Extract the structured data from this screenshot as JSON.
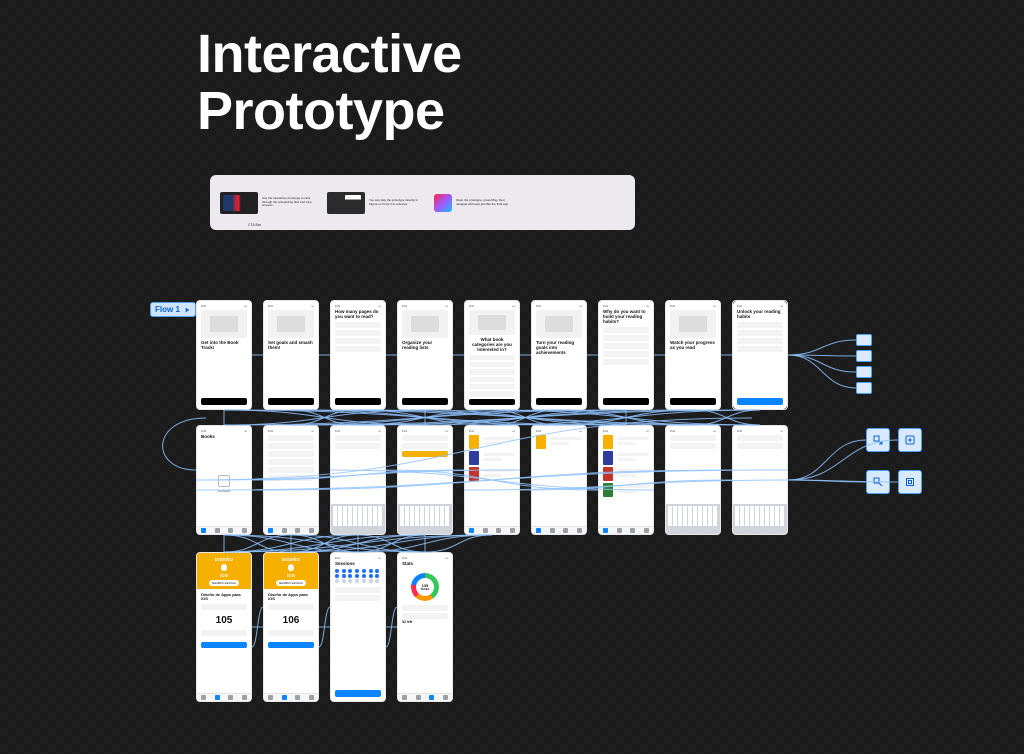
{
  "title_line1": "Interactive",
  "title_line2": "Prototype",
  "demo": {
    "caption": "CTA Bar",
    "note1": "Use the interactive prototype to click through the onboarding flow and core screens.",
    "note2": "You can play the prototype directly in Figma or mirror it to a device.",
    "note3": "Open the prototype, press Play, then navigate with taps just like the final app."
  },
  "flow_badge": "Flow 1",
  "row1": [
    {
      "heading": "Get into the Book Track!",
      "btn": "black"
    },
    {
      "heading": "Set goals and smash them!",
      "btn": "black"
    },
    {
      "heading": "How many pages do you want to read?",
      "btn": "black",
      "list": 4
    },
    {
      "heading": "Organize your reading lists",
      "btn": "black"
    },
    {
      "heading": "What book categories are you interested in?",
      "btn": "black",
      "list": 6,
      "center": true
    },
    {
      "heading": "Turn your reading goals into achievements",
      "btn": "black"
    },
    {
      "heading": "Why do you want to build your reading habits?",
      "btn": "black",
      "list": 5
    },
    {
      "heading": "Watch your progress as you read",
      "btn": "black"
    },
    {
      "heading": "Unlock your reading habits",
      "btn": "blue",
      "frame": true,
      "list": 4
    }
  ],
  "row2": [
    {
      "title": "Books",
      "type": "empty"
    },
    {
      "title": "",
      "type": "list",
      "rows": 6
    },
    {
      "title": "",
      "type": "keyboard"
    },
    {
      "title": "",
      "type": "keyboard",
      "marked": true
    },
    {
      "title": "",
      "type": "booklist",
      "thumbs": [
        "#f6b000",
        "#2f3e9e",
        "#c1352b"
      ]
    },
    {
      "title": "",
      "type": "booklist",
      "thumbs": [
        "#f6b000"
      ]
    },
    {
      "title": "",
      "type": "booklist",
      "thumbs": [
        "#f6b000",
        "#2f3e9e",
        "#c1352b",
        "#2e7d32"
      ]
    },
    {
      "title": "",
      "type": "keyboard"
    },
    {
      "title": "",
      "type": "keyboard"
    }
  ],
  "row3": [
    {
      "type": "book",
      "cover_label": "DISEÑO iOS",
      "sub": "Diseño de Apps para iOS",
      "metric": "105"
    },
    {
      "type": "book",
      "cover_label": "DISEÑO iOS",
      "sub": "Diseño de Apps para iOS",
      "metric": "106"
    },
    {
      "type": "sessions",
      "title": "Sessions",
      "btn": "blue"
    },
    {
      "type": "stats",
      "title": "Stats",
      "value": "135",
      "unit": "PAGES",
      "footer": "32 left"
    }
  ],
  "overlays": [
    "export-icon",
    "settings-icon",
    "share-icon",
    "present-icon"
  ]
}
